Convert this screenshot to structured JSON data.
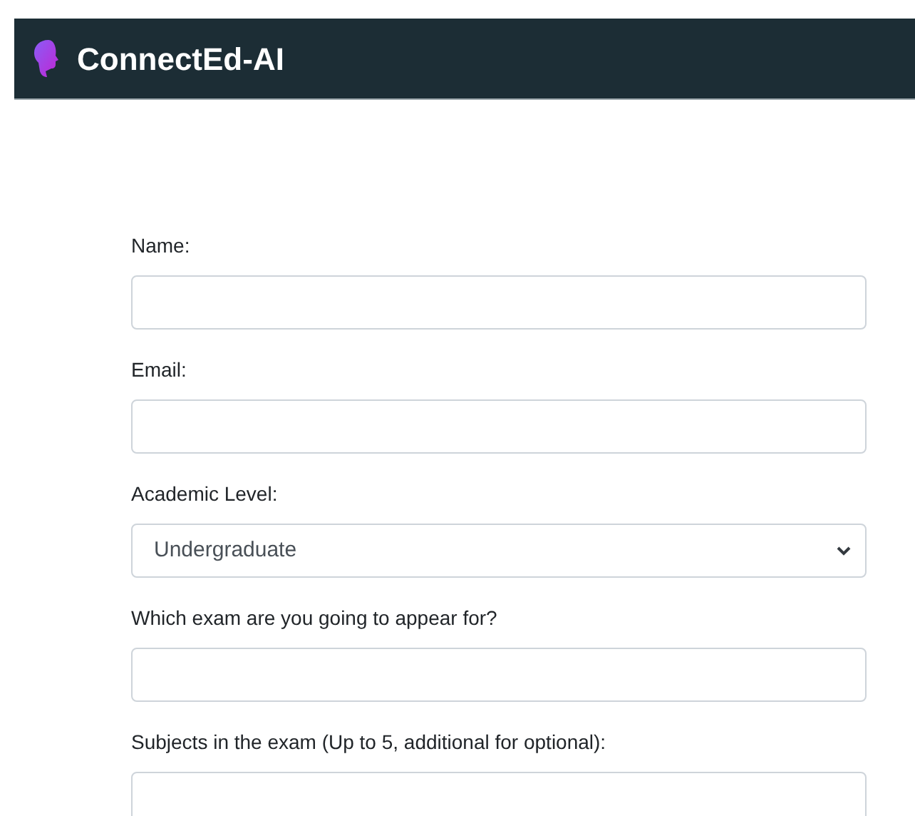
{
  "header": {
    "brand": "ConnectEd-AI"
  },
  "form": {
    "fields": [
      {
        "kind": "text",
        "label": "Name:"
      },
      {
        "kind": "text",
        "label": "Email:"
      },
      {
        "kind": "select",
        "label": "Academic Level:",
        "value": "Undergraduate"
      },
      {
        "kind": "text",
        "label": "Which exam are you going to appear for?"
      },
      {
        "kind": "text",
        "label": "Subjects in the exam (Up to 5, additional for optional):"
      }
    ]
  }
}
